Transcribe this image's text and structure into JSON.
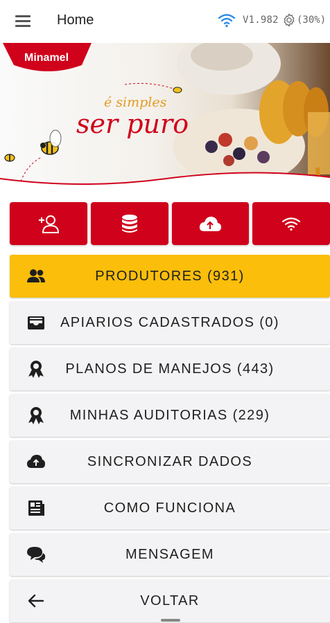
{
  "appbar": {
    "title": "Home",
    "version": "V1.982",
    "battery": "(30%)",
    "icons": {
      "menu": "hamburger-menu-icon",
      "wifi": "wifi-icon",
      "settings": "gear-icon"
    }
  },
  "banner": {
    "brand": "Minamel",
    "tagline_line1": "é simples",
    "tagline_line2": "ser puro",
    "colors": {
      "brand_red": "#d0021b",
      "honey": "#e39a21"
    }
  },
  "quick_actions": [
    {
      "name": "add-user",
      "icon": "add-user-icon"
    },
    {
      "name": "database",
      "icon": "database-icon"
    },
    {
      "name": "cloud-upload",
      "icon": "cloud-upload-icon"
    },
    {
      "name": "wifi",
      "icon": "wifi-icon"
    }
  ],
  "menu": [
    {
      "label": "PRODUTORES (931)",
      "icon": "people-icon",
      "highlight": true
    },
    {
      "label": "APIARIOS CADASTRADOS (0)",
      "icon": "inbox-icon"
    },
    {
      "label": "PLANOS DE MANEJOS (443)",
      "icon": "award-ribbon-icon"
    },
    {
      "label": "MINHAS AUDITORIAS (229)",
      "icon": "award-ribbon-icon"
    },
    {
      "label": "SINCRONIZAR DADOS",
      "icon": "cloud-upload-icon"
    },
    {
      "label": "COMO FUNCIONA",
      "icon": "newspaper-icon"
    },
    {
      "label": "MENSAGEM",
      "icon": "chat-bubbles-icon"
    },
    {
      "label": "VOLTAR",
      "icon": "arrow-back-icon"
    }
  ],
  "colors": {
    "accent_red": "#d0021b",
    "highlight_yellow": "#fbbe0a",
    "item_bg": "#f3f3f5"
  }
}
